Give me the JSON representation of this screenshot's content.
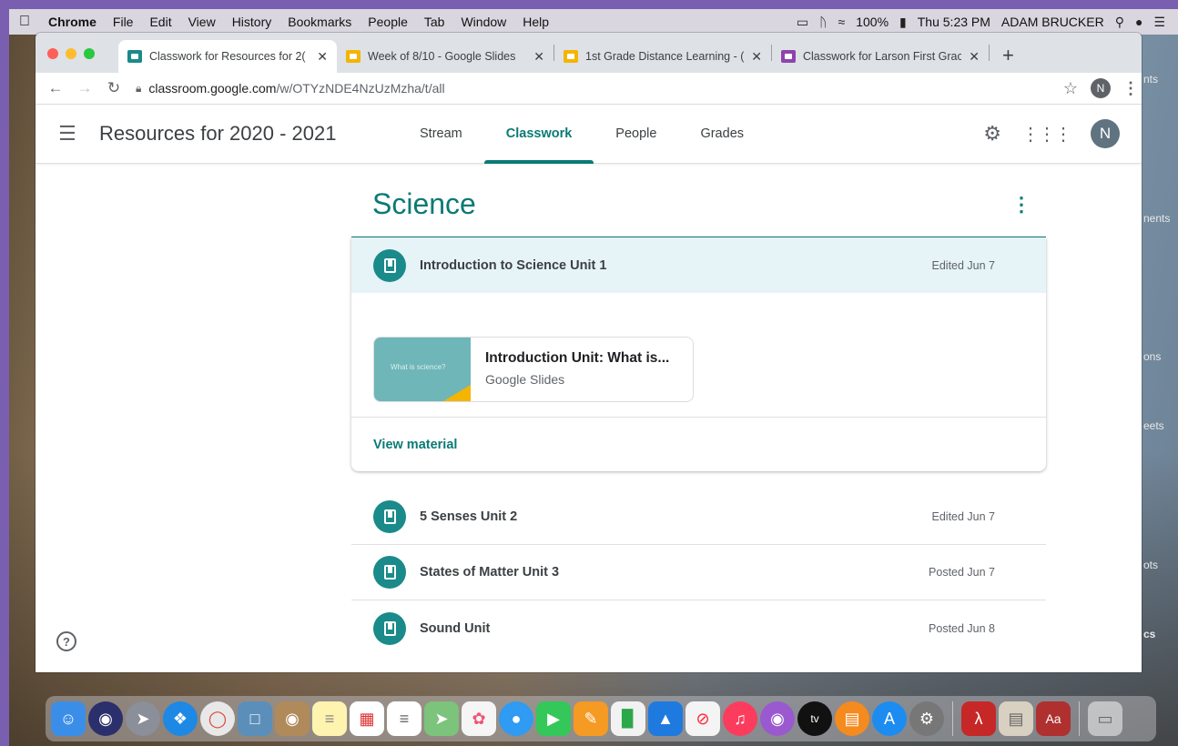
{
  "menubar": {
    "app": "Chrome",
    "items": [
      "File",
      "Edit",
      "View",
      "History",
      "Bookmarks",
      "People",
      "Tab",
      "Window",
      "Help"
    ],
    "battery": "100%",
    "datetime": "Thu 5:23 PM",
    "user": "ADAM BRUCKER"
  },
  "browser": {
    "tabs": [
      {
        "label": "Classwork for Resources for 2(",
        "color": "#1a8a8a",
        "active": true
      },
      {
        "label": "Week of 8/10 - Google Slides",
        "color": "#f4b400",
        "active": false
      },
      {
        "label": "1st Grade Distance Learning - (",
        "color": "#f4b400",
        "active": false
      },
      {
        "label": "Classwork for Larson First Grac",
        "color": "#8e44ad",
        "active": false
      }
    ],
    "url_host": "classroom.google.com",
    "url_path": "/w/OTYzNDE4NzUzMzha/t/all",
    "profile_initial": "N"
  },
  "app": {
    "class_name": "Resources for 2020 - 2021",
    "nav_tabs": [
      "Stream",
      "Classwork",
      "People",
      "Grades"
    ],
    "active_tab": "Classwork",
    "avatar_initial": "N"
  },
  "topic": {
    "title": "Science",
    "expanded_item": {
      "title": "Introduction to Science Unit 1",
      "date": "Edited Jun 7",
      "attachment": {
        "title": "Introduction Unit: What is...",
        "type": "Google Slides",
        "thumb_text": "What is science?"
      },
      "action": "View material"
    },
    "items": [
      {
        "title": "5 Senses Unit 2",
        "date": "Edited Jun 7"
      },
      {
        "title": "States of Matter Unit 3",
        "date": "Posted Jun 7"
      },
      {
        "title": "Sound Unit",
        "date": "Posted Jun 8"
      }
    ]
  },
  "side_labels": [
    "nts",
    "nents",
    "ons",
    "eets",
    "ots",
    "cs"
  ],
  "colors": {
    "accent": "#0b7a75",
    "highlight_row": "#e6f4f7"
  },
  "dock": [
    "finder",
    "siri",
    "launchpad",
    "safari",
    "chrome",
    "preview",
    "contacts",
    "notes",
    "calendar",
    "reminders",
    "maps",
    "photos",
    "messages",
    "facetime",
    "pages",
    "numbers",
    "keynote",
    "news",
    "music",
    "podcasts",
    "tv",
    "books",
    "app-store",
    "system-preferences",
    "acrobat",
    "archive",
    "dictionary",
    "trash"
  ]
}
